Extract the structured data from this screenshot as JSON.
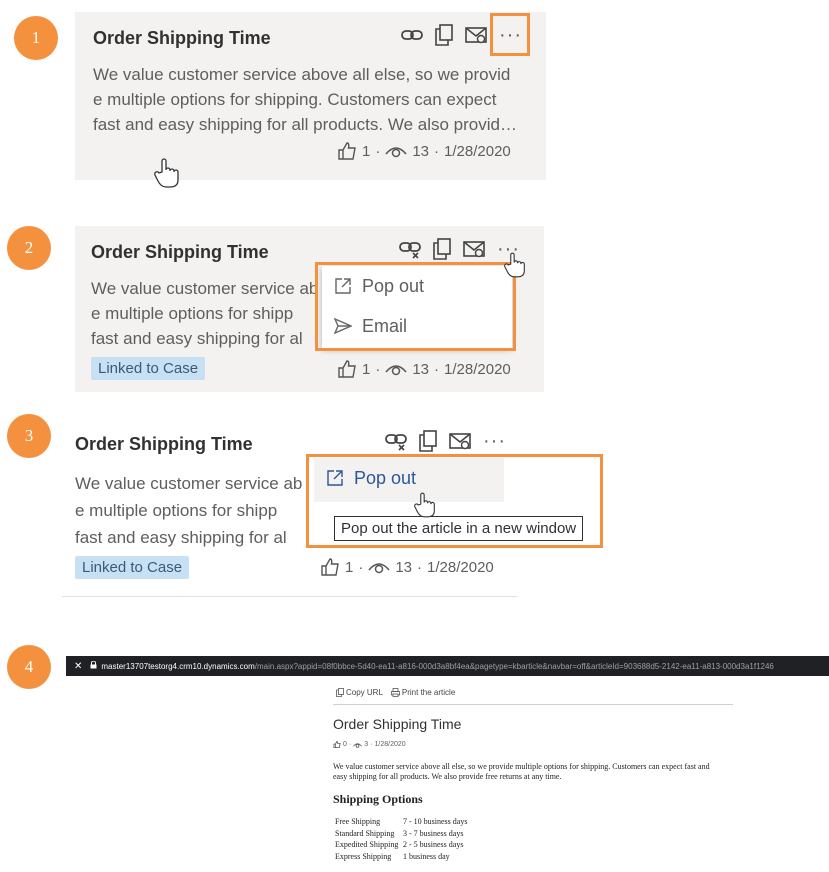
{
  "steps": [
    "1",
    "2",
    "3",
    "4"
  ],
  "article": {
    "title": "Order Shipping Time",
    "line1": "We value customer service above all else, so we provid",
    "line2": "e multiple options for shipping. Customers can expect",
    "line3": "fast and easy shipping for all products. We also provid…",
    "line1_short": "We value customer service ab",
    "line2_short": "e multiple options for shipp",
    "line3_short": "fast and easy shipping for al",
    "likes": "1",
    "views": "13",
    "sep": "·",
    "date": "1/28/2020",
    "badge": "Linked to Case",
    "more": "···"
  },
  "menu": {
    "popout": "Pop out",
    "email": "Email"
  },
  "tooltip": "Pop out the article in a new window",
  "browser": {
    "close": "✕",
    "host": "master13707testorg4.crm10.dynamics.com",
    "path": "/main.aspx?appid=08f0bbce-5d40-ea11-a816-000d3a8bf4ea&pagetype=kbarticle&navbar=off&articleId=903688d5-2142-ea11-a813-000d3a1f1246"
  },
  "popped": {
    "copy_url": "Copy URL",
    "print": "Print the article",
    "title": "Order Shipping Time",
    "likes": "0",
    "views": "3",
    "date": "1/28/2020",
    "para1": "We value customer service above all else, so we provide multiple options for shipping. Customers can expect fast and",
    "para2": "easy shipping for all products. We also provide free returns at any time.",
    "heading": "Shipping Options",
    "rows": [
      {
        "type": "Free Shipping",
        "time": "7 - 10 business days"
      },
      {
        "type": "Standard Shipping",
        "time": "3 - 7 business days"
      },
      {
        "type": "Expedited Shipping",
        "time": "2 - 5 business days"
      },
      {
        "type": "Express Shipping",
        "time": "1 business day"
      }
    ]
  },
  "colors": {
    "accent": "#f4913f",
    "badge_bg": "#c7e0f4",
    "card_bg": "#f3f2f1"
  }
}
